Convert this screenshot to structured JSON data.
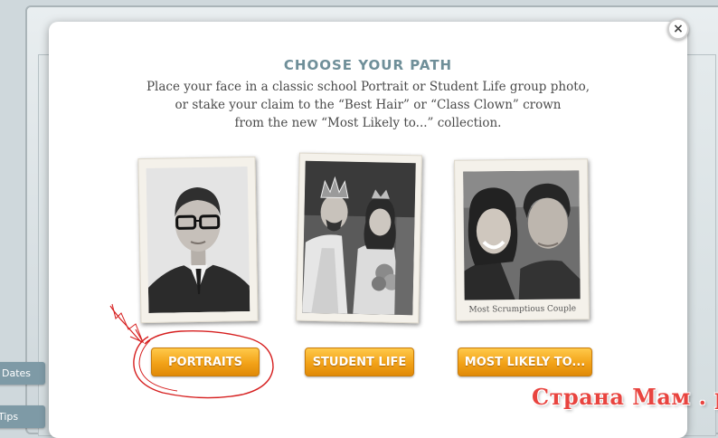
{
  "background": {
    "side_tabs": [
      "Dates",
      "Tips"
    ]
  },
  "modal": {
    "close_label": "×",
    "title": "CHOOSE YOUR PATH",
    "description_lines": [
      "Place your face in a classic school Portrait or Student Life group photo,",
      "or stake your claim to the “Best Hair” or “Class Clown” crown",
      "from the new “Most Likely to...” collection."
    ],
    "options": [
      {
        "photo_name": "portrait-photo",
        "button_label": "PORTRAITS"
      },
      {
        "photo_name": "student-life-photo",
        "button_label": "STUDENT LIFE"
      },
      {
        "photo_name": "most-likely-photo",
        "button_label": "MOST LIKELY TO...",
        "caption": "Most Scrumptious Couple"
      }
    ]
  },
  "colors": {
    "title": "#6f8f99",
    "button_gradient_top": "#ffc94a",
    "button_gradient_bottom": "#e08a08",
    "annotation": "#d61f1f",
    "watermark": "#e8443f"
  },
  "watermark": "Страна Мам . ру"
}
